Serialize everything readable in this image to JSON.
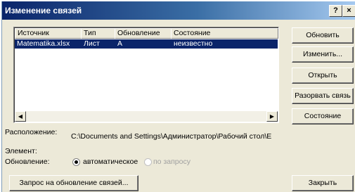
{
  "window": {
    "title": "Изменение связей",
    "help": "?",
    "close": "×"
  },
  "list": {
    "columns": [
      "Источник",
      "Тип",
      "Обновление",
      "Состояние"
    ],
    "rows": [
      {
        "source": "Matematika.xlsx",
        "type": "Лист",
        "update": "A",
        "status": "неизвестно"
      }
    ]
  },
  "buttons": {
    "update": "Обновить",
    "change": "Изменить...",
    "open": "Открыть",
    "break": "Разорвать связь",
    "status": "Состояние",
    "close": "Закрыть",
    "startup": "Запрос на обновление связей..."
  },
  "details": {
    "location_label": "Расположение:",
    "location_value": "C:\\Documents and Settings\\Администратор\\Рабочий стол\\E",
    "element_label": "Элемент:",
    "update_label": "Обновление:",
    "auto_label": "автоматическое",
    "manual_label": "по запросу"
  },
  "icons": {
    "scroll_left": "◀",
    "scroll_right": "▶"
  }
}
